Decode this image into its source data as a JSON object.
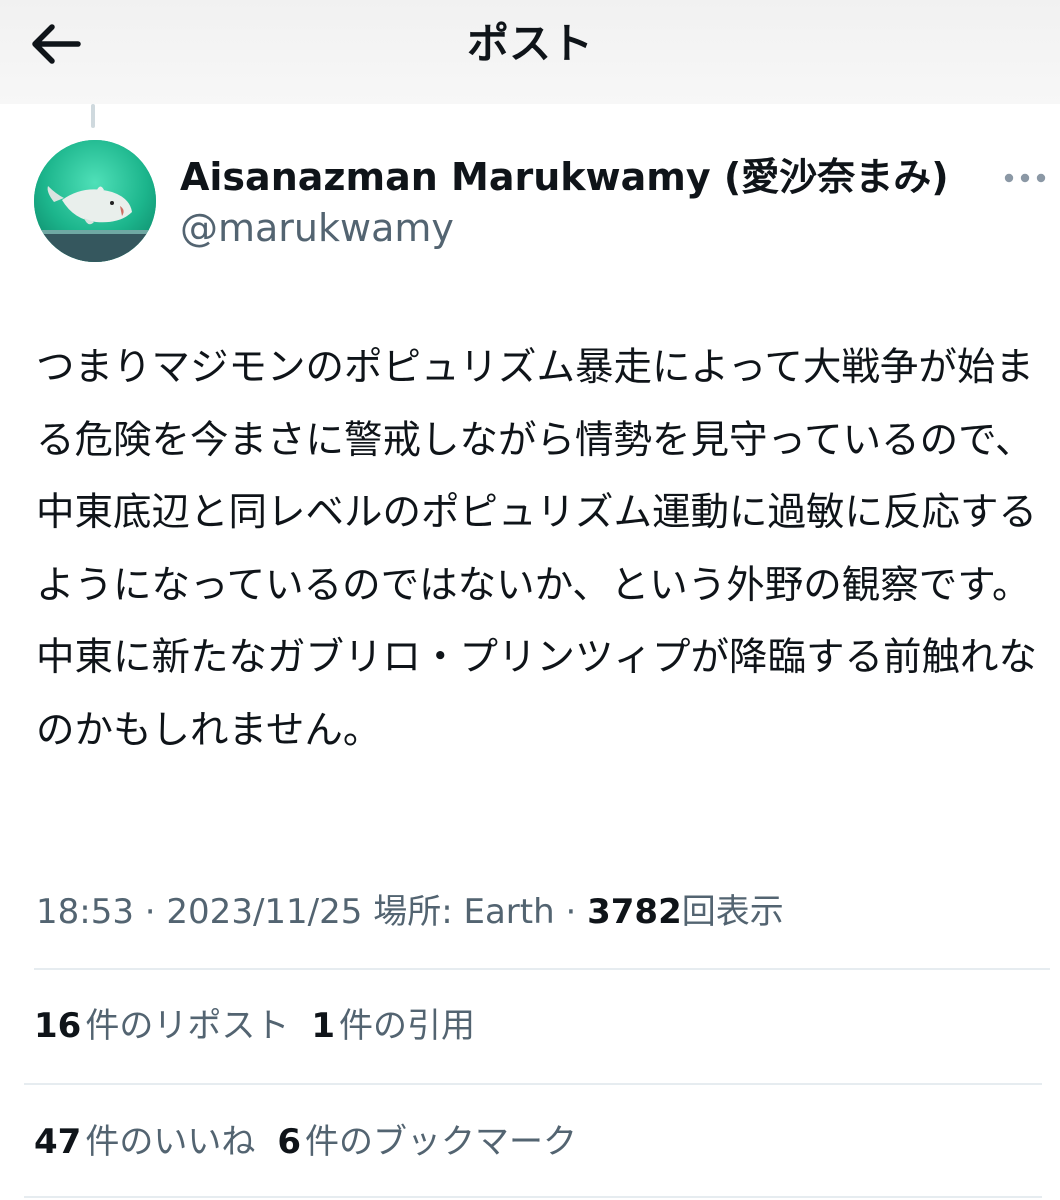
{
  "header": {
    "title": "ポスト",
    "back_icon": "arrow-left-icon"
  },
  "author": {
    "display_name": "Aisanazman Marukwamy (愛沙奈まみ)",
    "handle": "@marukwamy",
    "avatar": "aquarium-whale-avatar"
  },
  "tweet": {
    "text": "つまりマジモンのポピュリズム暴走によって大戦争が始まる危険を今まさに警戒しながら情勢を見守っているので、中東底辺と同レベルのポピュリズム運動に過敏に反応するようになっているのではないか、という外野の観察です。中東に新たなガブリロ・プリンツィプが降臨する前触れなのかもしれません。"
  },
  "meta": {
    "time": "18:53",
    "sep1": " · ",
    "date": "2023/11/25",
    "location": "場所: Earth",
    "sep2": " · ",
    "views_count": "3782",
    "views_label": "回表示"
  },
  "stats": {
    "reposts_count": "16",
    "reposts_label": "件のリポスト",
    "quotes_count": "1",
    "quotes_label": "件の引用",
    "likes_count": "47",
    "likes_label": "件のいいね",
    "bookmarks_count": "6",
    "bookmarks_label": "件のブックマーク"
  },
  "colors": {
    "primary_text": "#0f1419",
    "secondary_text": "#536471",
    "divider": "#e6ecf0",
    "avatar_bg": "#1fae8a"
  }
}
